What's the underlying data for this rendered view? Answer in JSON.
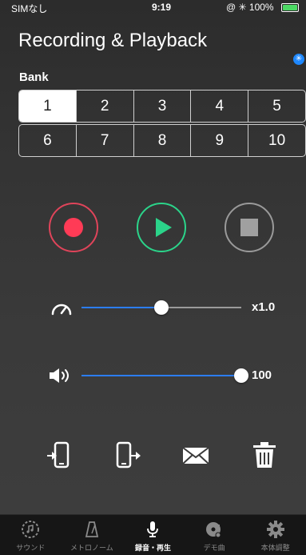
{
  "status": {
    "carrier": "SIMなし",
    "time": "9:19",
    "indicators": "@ ✳ 100%",
    "battery_level": 1.0
  },
  "title": "Recording & Playback",
  "bank": {
    "label": "Bank",
    "selected": "1",
    "row1": [
      "1",
      "2",
      "3",
      "4",
      "5"
    ],
    "row2": [
      "6",
      "7",
      "8",
      "9",
      "10"
    ]
  },
  "transport": {
    "record_icon": "record-icon",
    "play_icon": "play-icon",
    "stop_icon": "stop-icon"
  },
  "speed": {
    "icon": "speedometer-icon",
    "value_label": "x1.0",
    "level": 0.5
  },
  "volume": {
    "icon": "speaker-icon",
    "value_label": "100",
    "level": 1.0
  },
  "tools": [
    "import-phone-icon",
    "export-phone-icon",
    "mail-icon",
    "trash-icon"
  ],
  "tabs": [
    {
      "label": "サウンド",
      "icon": "sound-icon",
      "active": false
    },
    {
      "label": "メトロノーム",
      "icon": "metronome-icon",
      "active": false
    },
    {
      "label": "録音・再生",
      "icon": "microphone-icon",
      "active": true
    },
    {
      "label": "デモ曲",
      "icon": "demo-song-icon",
      "active": false
    },
    {
      "label": "本体調整",
      "icon": "gear-icon",
      "active": false
    }
  ],
  "colors": {
    "accent": "#2b7df6",
    "record": "#ff3b56",
    "play": "#2bd48a",
    "stop": "#a0a0a0"
  }
}
